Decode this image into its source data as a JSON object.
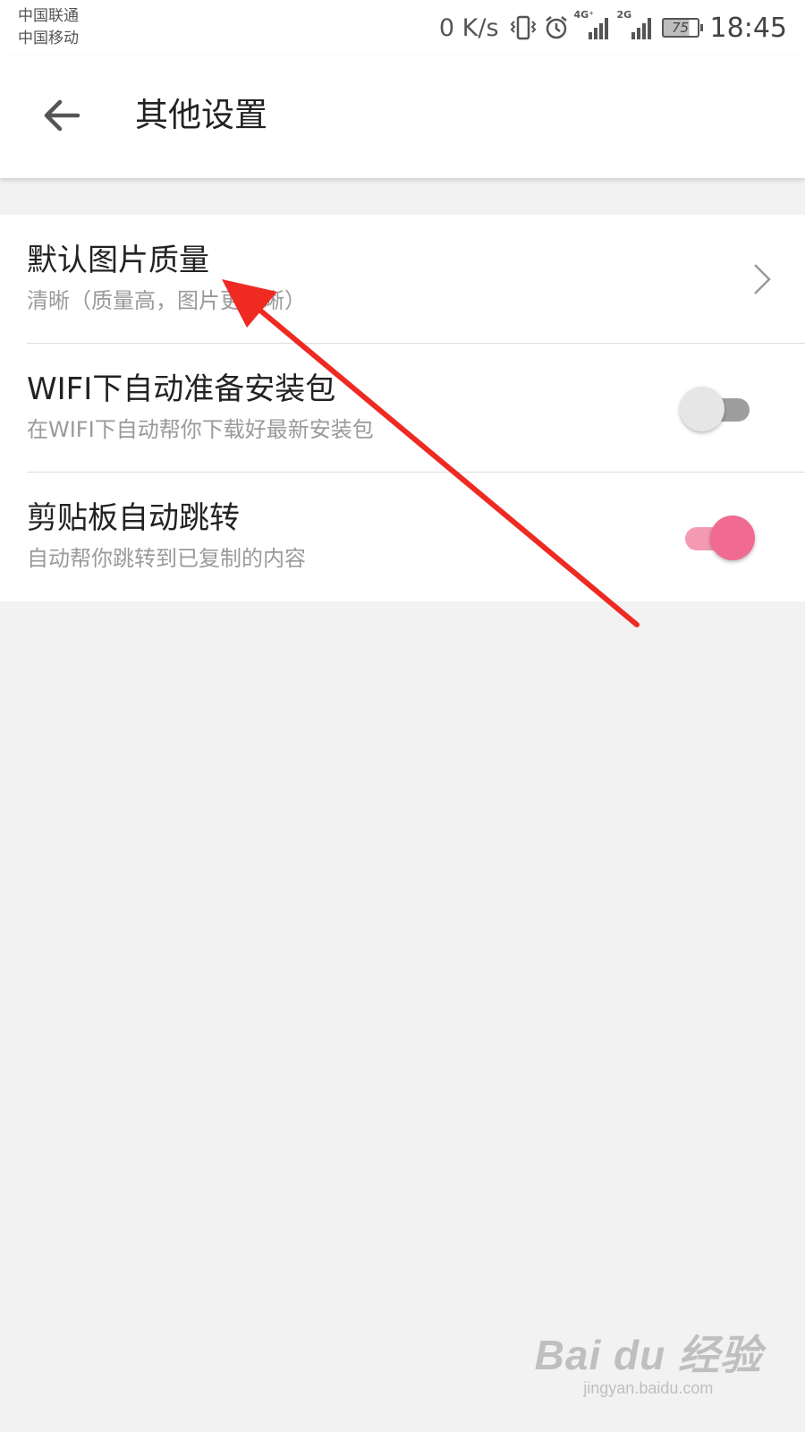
{
  "status_bar": {
    "carrier_1": "中国联通",
    "carrier_2": "中国移动",
    "net_speed": "0 K/s",
    "sim1_network": "4G⁺",
    "sim2_network": "2G",
    "battery_level": "75",
    "time": "18:45",
    "icons": [
      "vibrate-icon",
      "alarm-icon",
      "signal-4g-icon",
      "signal-2g-icon",
      "battery-icon"
    ]
  },
  "header": {
    "back_icon": "arrow-left-icon",
    "title": "其他设置"
  },
  "settings": {
    "items": [
      {
        "title": "默认图片质量",
        "subtitle": "清晰（质量高，图片更清晰）",
        "control": "chevron-right-icon"
      },
      {
        "title": "WIFI下自动准备安装包",
        "subtitle": "在WIFI下自动帮你下载好最新安装包",
        "control": "toggle",
        "enabled": false
      },
      {
        "title": "剪贴板自动跳转",
        "subtitle": "自动帮你跳转到已复制的内容",
        "control": "toggle",
        "enabled": true
      }
    ]
  },
  "colors": {
    "background": "#f2f2f2",
    "surface": "#ffffff",
    "toggle_on_knob": "#f06b8f",
    "toggle_on_track": "#f49ab2",
    "toggle_off_knob": "#e6e6e6",
    "toggle_off_track": "#9e9e9e",
    "annotation_arrow": "#ee2a22"
  },
  "watermark": {
    "logo": "Bai du 经验",
    "url": "jingyan.baidu.com"
  }
}
